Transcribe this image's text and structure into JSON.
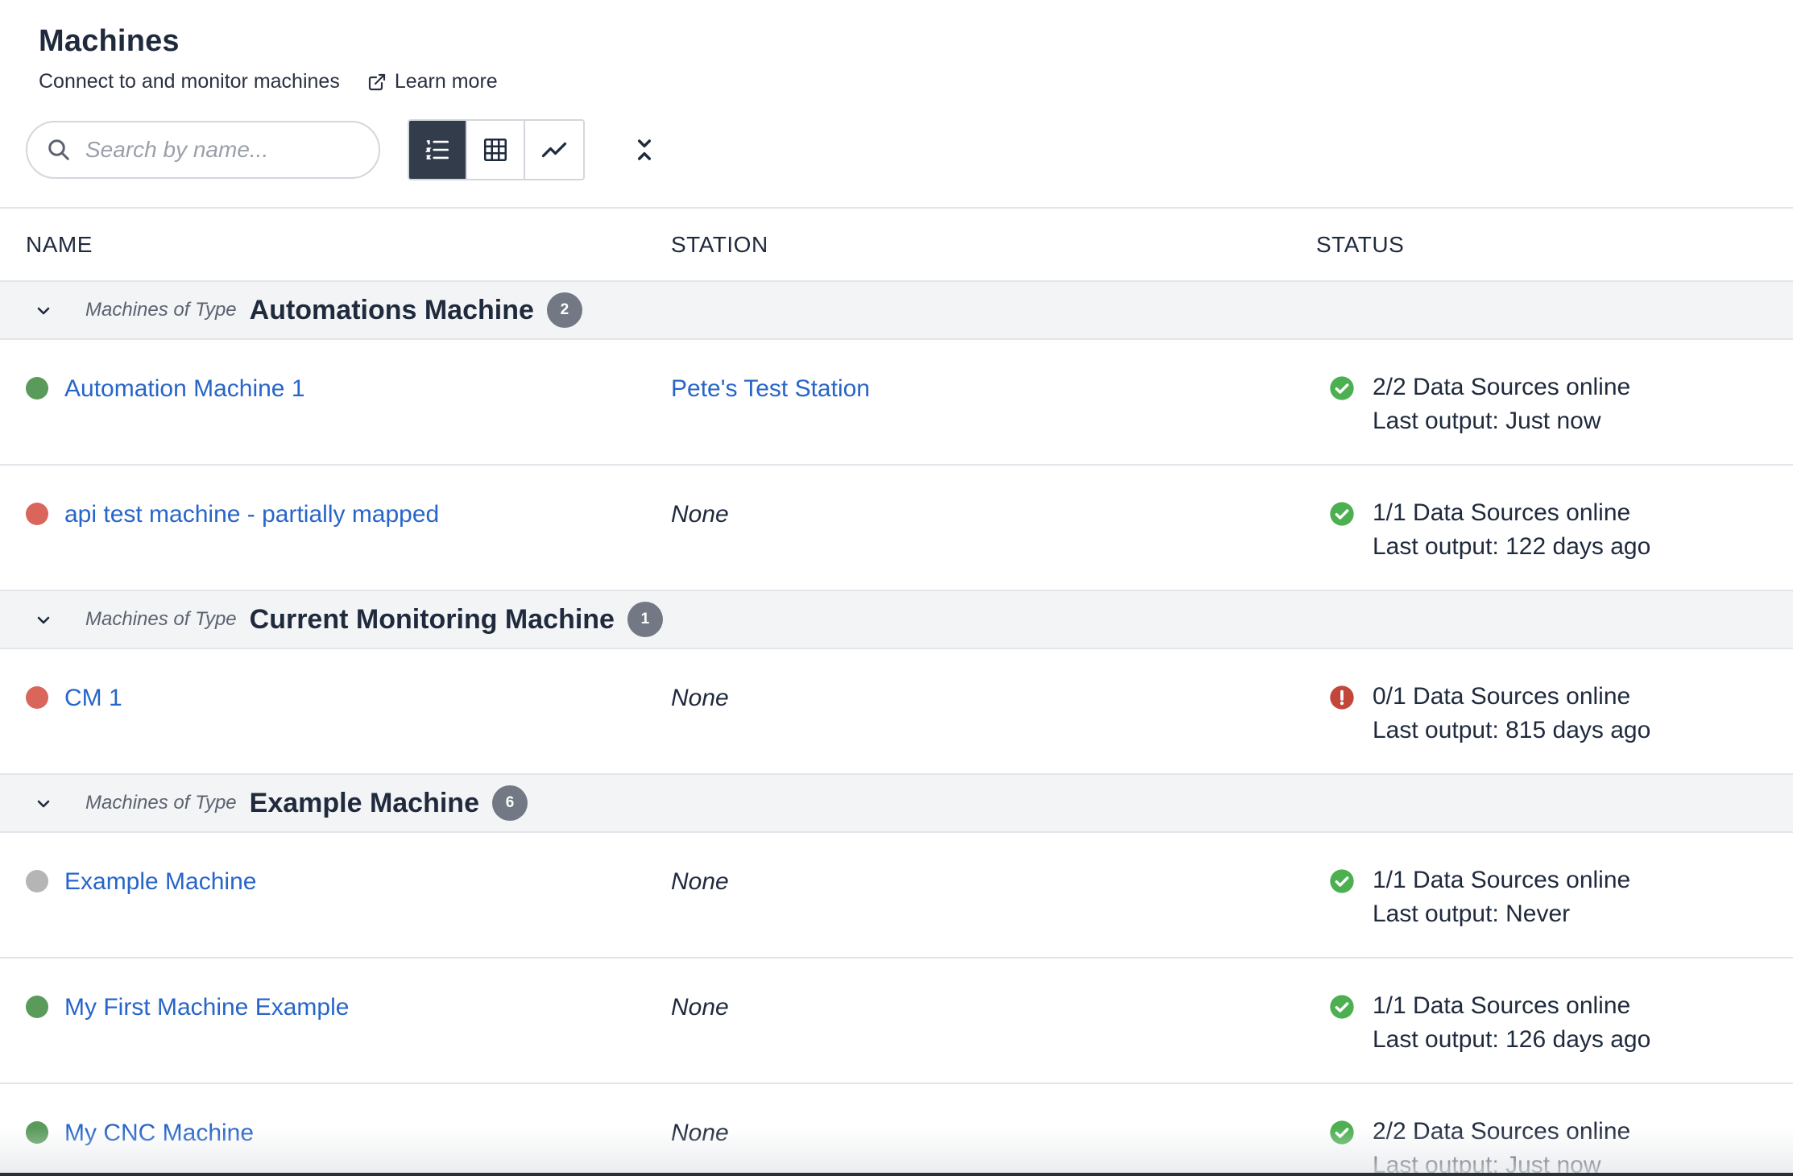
{
  "header": {
    "title": "Machines",
    "subtitle": "Connect to and monitor machines",
    "learn_more": "Learn more"
  },
  "toolbar": {
    "search_placeholder": "Search by name..."
  },
  "columns": {
    "name": "NAME",
    "station": "STATION",
    "status": "STATUS"
  },
  "colors": {
    "online": "#5a9a5a",
    "offline": "#d9655b",
    "unknown": "#b5b5b5",
    "ok_icon": "#4caf50",
    "error_icon": "#c2473a",
    "link": "#2765c9"
  },
  "groups": [
    {
      "prefix": "Machines of Type",
      "type": "Automations Machine",
      "count": "2",
      "machines": [
        {
          "name": "Automation Machine 1",
          "state": "online",
          "station": "Pete's Test Station",
          "status_icon": "check-circle-icon",
          "sources": "2/2 Data Sources online",
          "last_output": "Last output: Just now"
        },
        {
          "name": "api test machine - partially mapped",
          "state": "offline",
          "station": "None",
          "status_icon": "check-circle-icon",
          "sources": "1/1 Data Sources online",
          "last_output": "Last output: 122 days ago"
        }
      ]
    },
    {
      "prefix": "Machines of Type",
      "type": "Current Monitoring Machine",
      "count": "1",
      "machines": [
        {
          "name": "CM 1",
          "state": "offline",
          "station": "None",
          "status_icon": "alert-circle-icon",
          "sources": "0/1 Data Sources online",
          "last_output": "Last output: 815 days ago"
        }
      ]
    },
    {
      "prefix": "Machines of Type",
      "type": "Example Machine",
      "count": "6",
      "machines": [
        {
          "name": "Example Machine",
          "state": "unknown",
          "station": "None",
          "status_icon": "check-circle-icon",
          "sources": "1/1 Data Sources online",
          "last_output": "Last output: Never"
        },
        {
          "name": "My First Machine Example",
          "state": "online",
          "station": "None",
          "status_icon": "check-circle-icon",
          "sources": "1/1 Data Sources online",
          "last_output": "Last output: 126 days ago"
        },
        {
          "name": "My CNC Machine",
          "state": "online",
          "station": "None",
          "status_icon": "check-circle-icon",
          "sources": "2/2 Data Sources online",
          "last_output": "Last output: Just now"
        }
      ]
    }
  ]
}
